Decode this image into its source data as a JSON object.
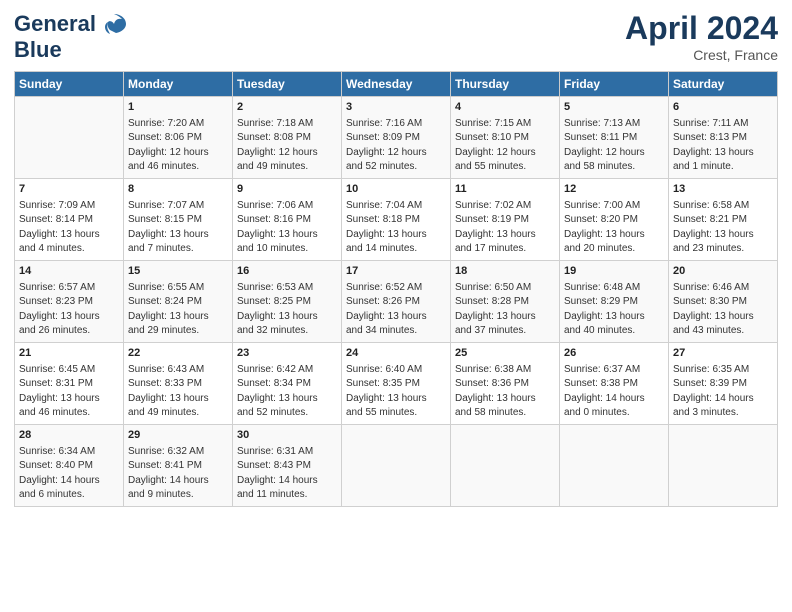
{
  "header": {
    "logo_line1": "General",
    "logo_line2": "Blue",
    "title": "April 2024",
    "subtitle": "Crest, France"
  },
  "days_of_week": [
    "Sunday",
    "Monday",
    "Tuesday",
    "Wednesday",
    "Thursday",
    "Friday",
    "Saturday"
  ],
  "weeks": [
    [
      {
        "day": "",
        "info": ""
      },
      {
        "day": "1",
        "info": "Sunrise: 7:20 AM\nSunset: 8:06 PM\nDaylight: 12 hours\nand 46 minutes."
      },
      {
        "day": "2",
        "info": "Sunrise: 7:18 AM\nSunset: 8:08 PM\nDaylight: 12 hours\nand 49 minutes."
      },
      {
        "day": "3",
        "info": "Sunrise: 7:16 AM\nSunset: 8:09 PM\nDaylight: 12 hours\nand 52 minutes."
      },
      {
        "day": "4",
        "info": "Sunrise: 7:15 AM\nSunset: 8:10 PM\nDaylight: 12 hours\nand 55 minutes."
      },
      {
        "day": "5",
        "info": "Sunrise: 7:13 AM\nSunset: 8:11 PM\nDaylight: 12 hours\nand 58 minutes."
      },
      {
        "day": "6",
        "info": "Sunrise: 7:11 AM\nSunset: 8:13 PM\nDaylight: 13 hours\nand 1 minute."
      }
    ],
    [
      {
        "day": "7",
        "info": "Sunrise: 7:09 AM\nSunset: 8:14 PM\nDaylight: 13 hours\nand 4 minutes."
      },
      {
        "day": "8",
        "info": "Sunrise: 7:07 AM\nSunset: 8:15 PM\nDaylight: 13 hours\nand 7 minutes."
      },
      {
        "day": "9",
        "info": "Sunrise: 7:06 AM\nSunset: 8:16 PM\nDaylight: 13 hours\nand 10 minutes."
      },
      {
        "day": "10",
        "info": "Sunrise: 7:04 AM\nSunset: 8:18 PM\nDaylight: 13 hours\nand 14 minutes."
      },
      {
        "day": "11",
        "info": "Sunrise: 7:02 AM\nSunset: 8:19 PM\nDaylight: 13 hours\nand 17 minutes."
      },
      {
        "day": "12",
        "info": "Sunrise: 7:00 AM\nSunset: 8:20 PM\nDaylight: 13 hours\nand 20 minutes."
      },
      {
        "day": "13",
        "info": "Sunrise: 6:58 AM\nSunset: 8:21 PM\nDaylight: 13 hours\nand 23 minutes."
      }
    ],
    [
      {
        "day": "14",
        "info": "Sunrise: 6:57 AM\nSunset: 8:23 PM\nDaylight: 13 hours\nand 26 minutes."
      },
      {
        "day": "15",
        "info": "Sunrise: 6:55 AM\nSunset: 8:24 PM\nDaylight: 13 hours\nand 29 minutes."
      },
      {
        "day": "16",
        "info": "Sunrise: 6:53 AM\nSunset: 8:25 PM\nDaylight: 13 hours\nand 32 minutes."
      },
      {
        "day": "17",
        "info": "Sunrise: 6:52 AM\nSunset: 8:26 PM\nDaylight: 13 hours\nand 34 minutes."
      },
      {
        "day": "18",
        "info": "Sunrise: 6:50 AM\nSunset: 8:28 PM\nDaylight: 13 hours\nand 37 minutes."
      },
      {
        "day": "19",
        "info": "Sunrise: 6:48 AM\nSunset: 8:29 PM\nDaylight: 13 hours\nand 40 minutes."
      },
      {
        "day": "20",
        "info": "Sunrise: 6:46 AM\nSunset: 8:30 PM\nDaylight: 13 hours\nand 43 minutes."
      }
    ],
    [
      {
        "day": "21",
        "info": "Sunrise: 6:45 AM\nSunset: 8:31 PM\nDaylight: 13 hours\nand 46 minutes."
      },
      {
        "day": "22",
        "info": "Sunrise: 6:43 AM\nSunset: 8:33 PM\nDaylight: 13 hours\nand 49 minutes."
      },
      {
        "day": "23",
        "info": "Sunrise: 6:42 AM\nSunset: 8:34 PM\nDaylight: 13 hours\nand 52 minutes."
      },
      {
        "day": "24",
        "info": "Sunrise: 6:40 AM\nSunset: 8:35 PM\nDaylight: 13 hours\nand 55 minutes."
      },
      {
        "day": "25",
        "info": "Sunrise: 6:38 AM\nSunset: 8:36 PM\nDaylight: 13 hours\nand 58 minutes."
      },
      {
        "day": "26",
        "info": "Sunrise: 6:37 AM\nSunset: 8:38 PM\nDaylight: 14 hours\nand 0 minutes."
      },
      {
        "day": "27",
        "info": "Sunrise: 6:35 AM\nSunset: 8:39 PM\nDaylight: 14 hours\nand 3 minutes."
      }
    ],
    [
      {
        "day": "28",
        "info": "Sunrise: 6:34 AM\nSunset: 8:40 PM\nDaylight: 14 hours\nand 6 minutes."
      },
      {
        "day": "29",
        "info": "Sunrise: 6:32 AM\nSunset: 8:41 PM\nDaylight: 14 hours\nand 9 minutes."
      },
      {
        "day": "30",
        "info": "Sunrise: 6:31 AM\nSunset: 8:43 PM\nDaylight: 14 hours\nand 11 minutes."
      },
      {
        "day": "",
        "info": ""
      },
      {
        "day": "",
        "info": ""
      },
      {
        "day": "",
        "info": ""
      },
      {
        "day": "",
        "info": ""
      }
    ]
  ]
}
